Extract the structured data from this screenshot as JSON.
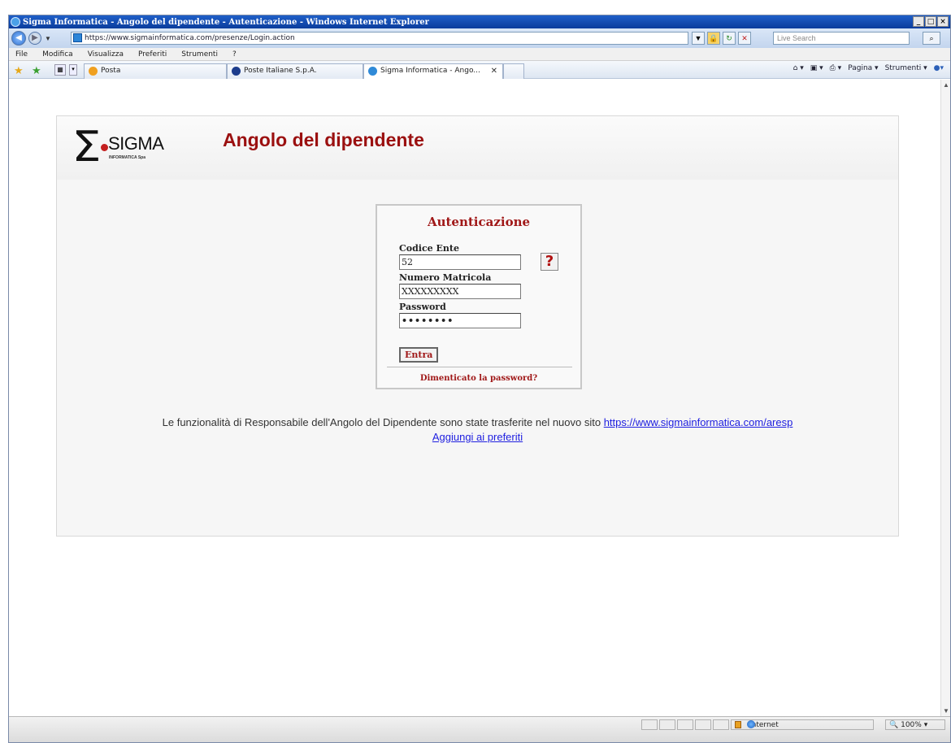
{
  "window": {
    "title": "Sigma Informatica - Angolo del dipendente - Autenticazione - Windows Internet Explorer",
    "controls": [
      "_",
      "□",
      "×"
    ]
  },
  "address": {
    "url": "https://www.sigmainformatica.com/presenze/Login.action",
    "search_placeholder": "Live Search"
  },
  "menu": {
    "items": [
      "File",
      "Modifica",
      "Visualizza",
      "Preferiti",
      "Strumenti",
      "?"
    ]
  },
  "tabs": [
    {
      "label": "Posta",
      "icon_color": "#f0a020"
    },
    {
      "label": "Poste Italiane S.p.A.",
      "icon_color": "#1c3c8c"
    },
    {
      "label": "Sigma Informatica - Ango...",
      "icon_color": "#2f8ad8",
      "active": true
    }
  ],
  "commands": [
    "Pagina ▾",
    "Strumenti ▾"
  ],
  "page": {
    "logo": {
      "text": "SIGMA",
      "sub": "INFORMATICA Spa"
    },
    "header_title": "Angolo del dipendente",
    "login": {
      "title": "Autenticazione",
      "codice_label": "Codice Ente",
      "codice_value": "52",
      "matricola_label": "Numero Matricola",
      "matricola_value": "XXXXXXXXX",
      "password_label": "Password",
      "password_value": "••••••••",
      "help": "?",
      "submit": "Entra",
      "forgot": "Dimenticato la password?"
    },
    "notice_text": "Le funzionalità di Responsabile dell'Angolo del Dipendente sono state trasferite nel nuovo sito ",
    "notice_link": "https://www.sigmainformatica.com/aresp",
    "favorites_link": "Aggiungi ai preferiti"
  },
  "status": {
    "zone": "Internet",
    "zoom": "100%"
  },
  "colors": {
    "brand_red": "#9b1010",
    "link_blue": "#2020e0"
  }
}
